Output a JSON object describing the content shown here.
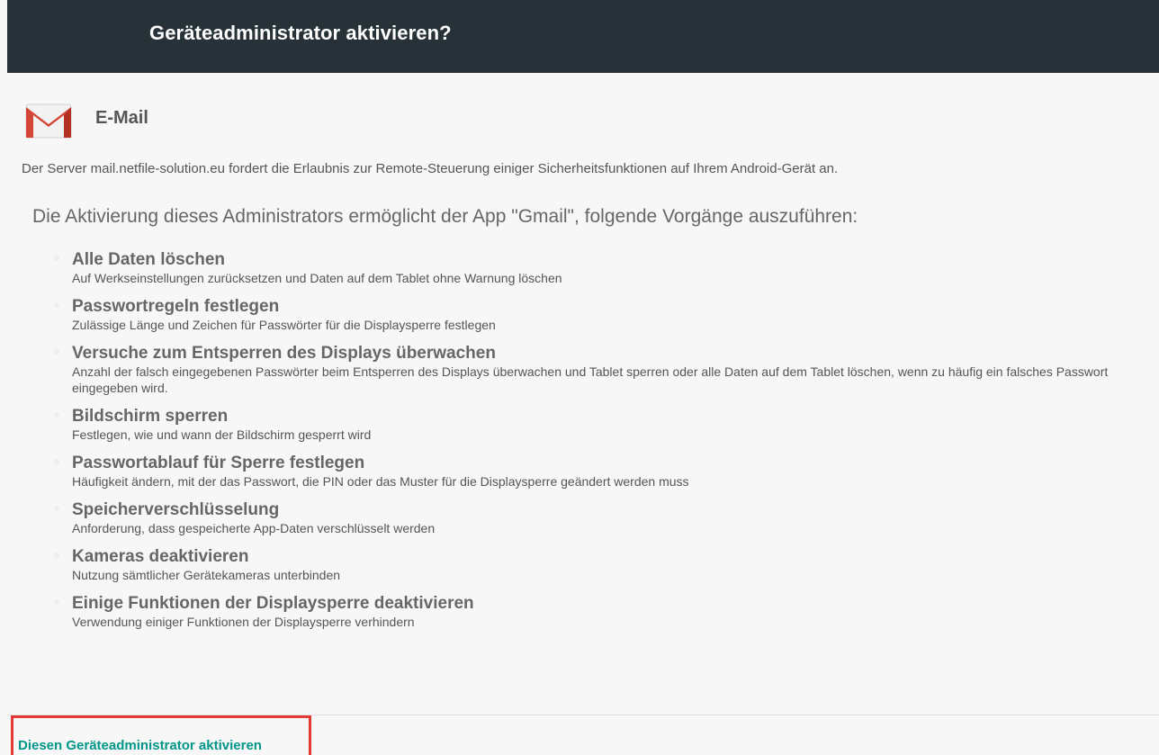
{
  "dialog": {
    "title": "Geräteadministrator aktivieren?"
  },
  "app": {
    "icon": "gmail-envelope-icon",
    "name": "E-Mail"
  },
  "server_message": "Der Server mail.netfile-solution.eu fordert die Erlaubnis zur Remote-Steuerung einiger Sicherheitsfunktionen auf Ihrem Android-Gerät an.",
  "intro": "Die Aktivierung dieses Administrators ermöglicht der App \"Gmail\", folgende Vorgänge auszuführen:",
  "policies": [
    {
      "title": "Alle Daten löschen",
      "description": "Auf Werkseinstellungen zurücksetzen und Daten auf dem Tablet ohne Warnung löschen"
    },
    {
      "title": "Passwortregeln festlegen",
      "description": "Zulässige Länge und Zeichen für Passwörter für die Displaysperre festlegen"
    },
    {
      "title": "Versuche zum Entsperren des Displays überwachen",
      "description": "Anzahl der falsch eingegebenen Passwörter beim Entsperren des Displays überwachen und Tablet sperren oder alle Daten auf dem Tablet löschen, wenn zu häufig ein falsches Passwort eingegeben wird."
    },
    {
      "title": "Bildschirm sperren",
      "description": "Festlegen, wie und wann der Bildschirm gesperrt wird"
    },
    {
      "title": "Passwortablauf für Sperre festlegen",
      "description": "Häufigkeit ändern, mit der das Passwort, die PIN oder das Muster für die Displaysperre geändert werden muss"
    },
    {
      "title": "Speicherverschlüsselung",
      "description": "Anforderung, dass gespeicherte App-Daten verschlüsselt werden"
    },
    {
      "title": "Kameras deaktivieren",
      "description": "Nutzung sämtlicher Gerätekameras unterbinden"
    },
    {
      "title": "Einige Funktionen der Displaysperre deaktivieren",
      "description": "Verwendung einiger Funktionen der Displaysperre verhindern"
    }
  ],
  "actions": {
    "activate_label": "Diesen Geräteadministrator aktivieren"
  },
  "colors": {
    "header_bg": "#263238",
    "accent": "#009688",
    "highlight": "#e53935",
    "gmail_red": "#d44638"
  }
}
